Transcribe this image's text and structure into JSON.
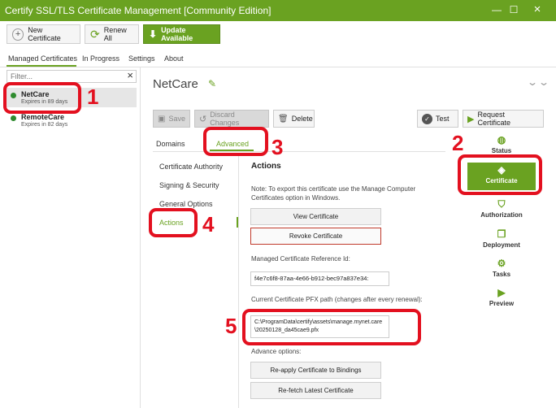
{
  "window": {
    "title": "Certify SSL/TLS Certificate Management [Community Edition]",
    "minimize_icon": "minimize-icon",
    "maximize_icon": "maximize-icon",
    "close_icon": "close-icon"
  },
  "toolbar": {
    "new_certificate": "New Certificate",
    "renew_all": "Renew All",
    "update_available": "Update Available"
  },
  "top_tabs": [
    "Managed Certificates",
    "In Progress",
    "Settings",
    "About"
  ],
  "filter": {
    "placeholder": "Filter..."
  },
  "certificates": [
    {
      "name": "NetCare",
      "expiry": "Expires in 89 days"
    },
    {
      "name": "RemoteCare",
      "expiry": "Expires in 82 days"
    }
  ],
  "detail": {
    "title": "NetCare",
    "buttons": {
      "save": "Save",
      "discard": "Discard Changes",
      "delete": "Delete",
      "test": "Test",
      "request": "Request Certificate"
    },
    "sub_tabs": [
      "Domains",
      "Advanced"
    ],
    "side_nav": [
      "Certificate Authority",
      "Signing & Security",
      "General Options",
      "Actions"
    ],
    "actions": {
      "heading": "Actions",
      "note": "Note: To export this certificate use the Manage Computer Certificates option in Windows.",
      "view_certificate": "View Certificate",
      "revoke_certificate": "Revoke Certificate",
      "ref_label": "Managed Certificate Reference Id:",
      "ref_value": "f4e7c6f8-87aa-4e66-b912-bec97a837e34:",
      "pfx_label": "Current Certificate PFX path (changes after every renewal):",
      "pfx_value": "C:\\ProgramData\\certify\\assets\\manage.mynet.care\\20250128_da45cae9.pfx",
      "advanced_label": "Advance options:",
      "reapply": "Re-apply Certificate to Bindings",
      "refetch": "Re-fetch Latest Certificate"
    }
  },
  "section_nav": [
    "Status",
    "Certificate",
    "Authorization",
    "Deployment",
    "Tasks",
    "Preview"
  ],
  "annotations": [
    "1",
    "2",
    "3",
    "4",
    "5"
  ],
  "colors": {
    "brand_green": "#6aa221",
    "annotation_red": "#e3101f",
    "status_green": "#2e8b2e"
  }
}
